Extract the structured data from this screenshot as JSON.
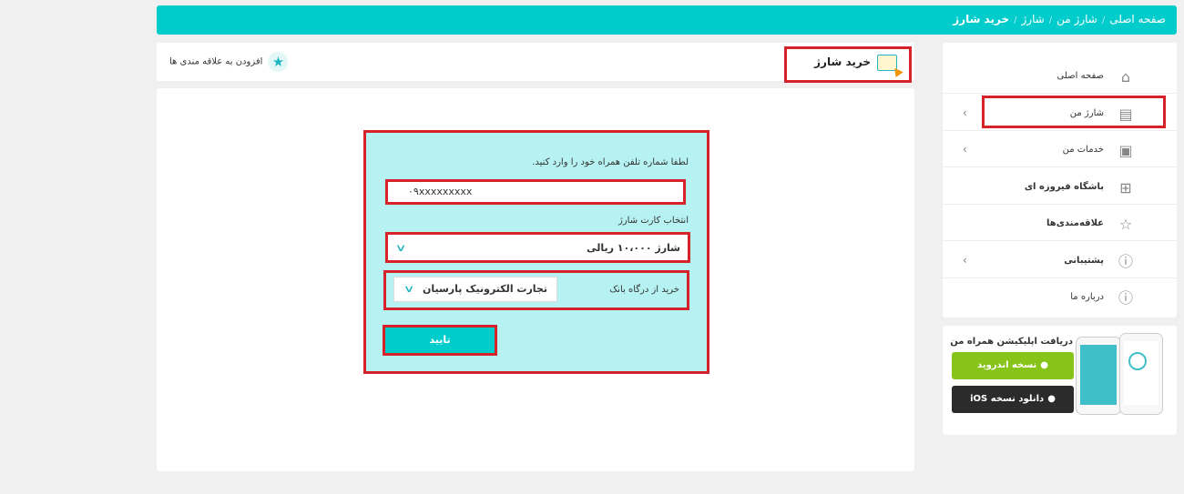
{
  "breadcrumb": {
    "home": "صفحه اصلی",
    "sep": "/",
    "my_charge": "شارژ من",
    "charge": "شارژ",
    "current": "خرید شارژ"
  },
  "page": {
    "title": "خرید شارژ",
    "favorite_label": "افزودن به علاقه مندی ها"
  },
  "form": {
    "phone_prompt": "لطفا شماره تلفن همراه خود را وارد کنید.",
    "phone_value": "۰۹xxxxxxxxx",
    "card_label": "انتخاب کارت شارژ",
    "card_value": "شارژ ۱۰،۰۰۰ ریالی",
    "bank_label": "خرید از درگاه بانک",
    "bank_value": "تجارت الکترونیک پارسیان",
    "confirm_label": "تایید"
  },
  "sidebar": {
    "items": [
      {
        "label": "صفحه اصلی",
        "icon": "home-icon",
        "arrow": ""
      },
      {
        "label": "شارژ من",
        "icon": "sim-card-icon",
        "arrow": "›"
      },
      {
        "label": "خدمات من",
        "icon": "services-icon",
        "arrow": "›"
      },
      {
        "label": "باشگاه فیروزه ای",
        "icon": "gift-icon",
        "arrow": ""
      },
      {
        "label": "علاقه‌مندی‌ها",
        "icon": "star-icon",
        "arrow": ""
      },
      {
        "label": "پشتیبانی",
        "icon": "help-icon",
        "arrow": "›"
      },
      {
        "label": "درباره ما",
        "icon": "info-icon",
        "arrow": ""
      }
    ]
  },
  "app": {
    "title": "دریافت اپلیکیشن همراه من",
    "android": "نسخه اندروید",
    "ios": "دانلود نسخه iOS"
  },
  "colors": {
    "accent": "#00cccc",
    "highlight": "#d6232a",
    "form_bg": "#b6f2f1",
    "android": "#86c41a",
    "ios": "#2b2b2b"
  }
}
